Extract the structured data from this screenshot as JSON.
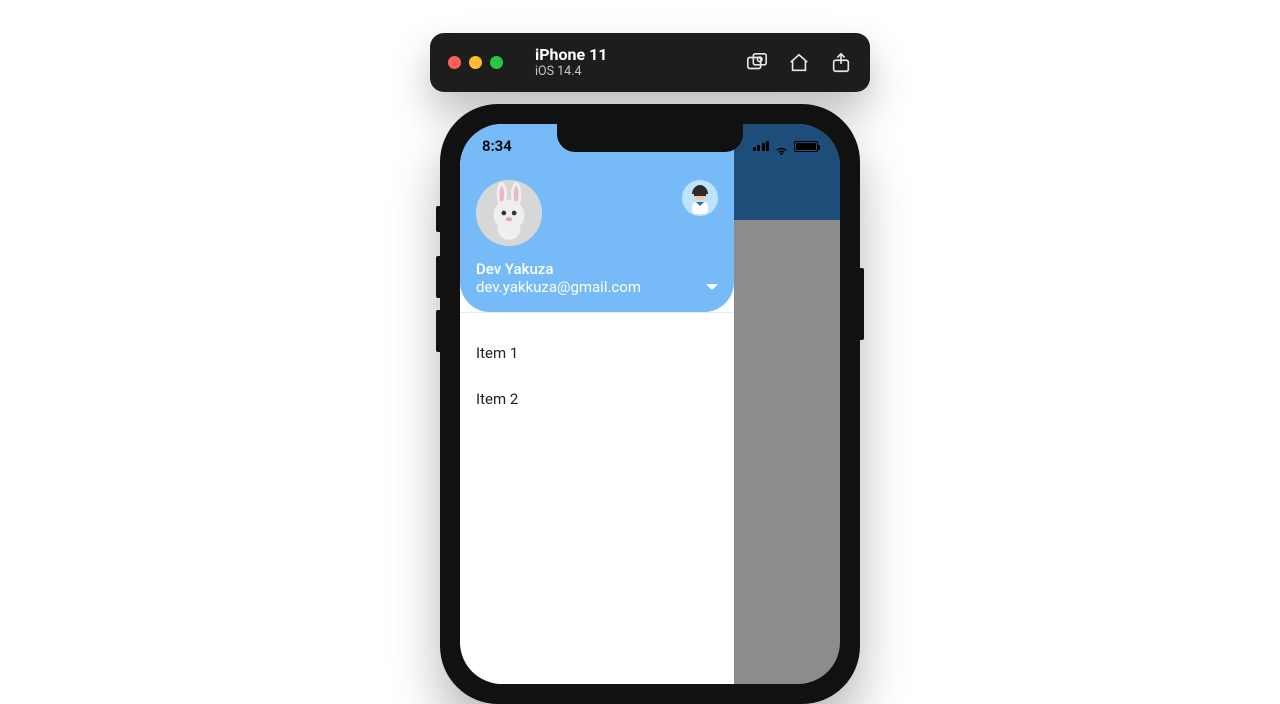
{
  "simulator": {
    "device_name": "iPhone 11",
    "os_version": "iOS 14.4"
  },
  "statusbar": {
    "time": "8:34"
  },
  "drawer": {
    "user_name": "Dev Yakuza",
    "user_email": "dev.yakkuza@gmail.com",
    "avatar_main": "bunny-avatar",
    "avatar_secondary": "man-avatar",
    "items": [
      {
        "label": "Item 1"
      },
      {
        "label": "Item 2"
      }
    ]
  },
  "colors": {
    "header_blue": "#1f4d7a",
    "drawer_blue": "#76bbf7"
  }
}
